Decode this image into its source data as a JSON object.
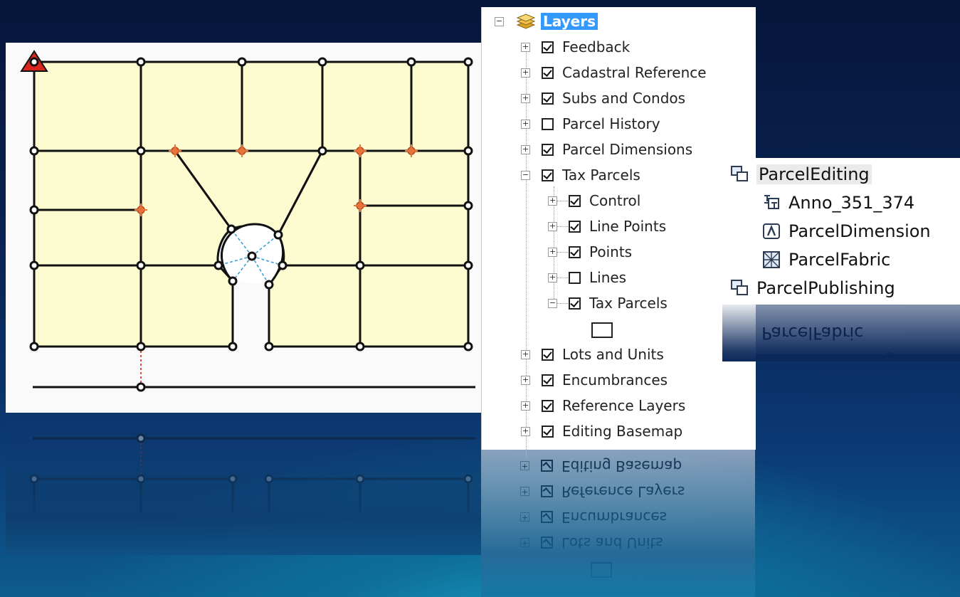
{
  "toc": {
    "title": "Layers",
    "items": [
      {
        "label": "Feedback",
        "checked": true,
        "expanded": false
      },
      {
        "label": "Cadastral Reference",
        "checked": true,
        "expanded": false
      },
      {
        "label": "Subs and Condos",
        "checked": true,
        "expanded": false
      },
      {
        "label": "Parcel History",
        "checked": false,
        "expanded": false
      },
      {
        "label": "Parcel Dimensions",
        "checked": true,
        "expanded": false
      },
      {
        "label": "Tax Parcels",
        "checked": true,
        "expanded": true
      }
    ],
    "children": [
      {
        "label": "Control",
        "checked": true
      },
      {
        "label": "Line Points",
        "checked": true
      },
      {
        "label": "Points",
        "checked": true
      },
      {
        "label": "Lines",
        "checked": false
      },
      {
        "label": "Tax Parcels",
        "checked": true
      }
    ],
    "items_after": [
      {
        "label": "Lots and Units",
        "checked": true
      },
      {
        "label": "Encumbrances",
        "checked": true
      },
      {
        "label": "Reference Layers",
        "checked": true
      },
      {
        "label": "Editing Basemap",
        "checked": true
      }
    ]
  },
  "catalog": {
    "items": [
      {
        "label": "ParcelEditing",
        "icon": "feature-dataset-icon",
        "level": 0
      },
      {
        "label": "Anno_351_374",
        "icon": "annotation-class-icon",
        "level": 1
      },
      {
        "label": "ParcelDimension",
        "icon": "dimension-class-icon",
        "level": 1
      },
      {
        "label": "ParcelFabric",
        "icon": "parcel-fabric-icon",
        "level": 1
      },
      {
        "label": "ParcelPublishing",
        "icon": "feature-dataset-icon",
        "level": 0
      }
    ]
  },
  "colors": {
    "parcel_fill": "#fdfbd0",
    "line": "#111111",
    "point_orange": "#e8743b",
    "radial_blue": "#3a9fd6",
    "selection": "#3399ff",
    "control_marker": "#d9261c"
  }
}
